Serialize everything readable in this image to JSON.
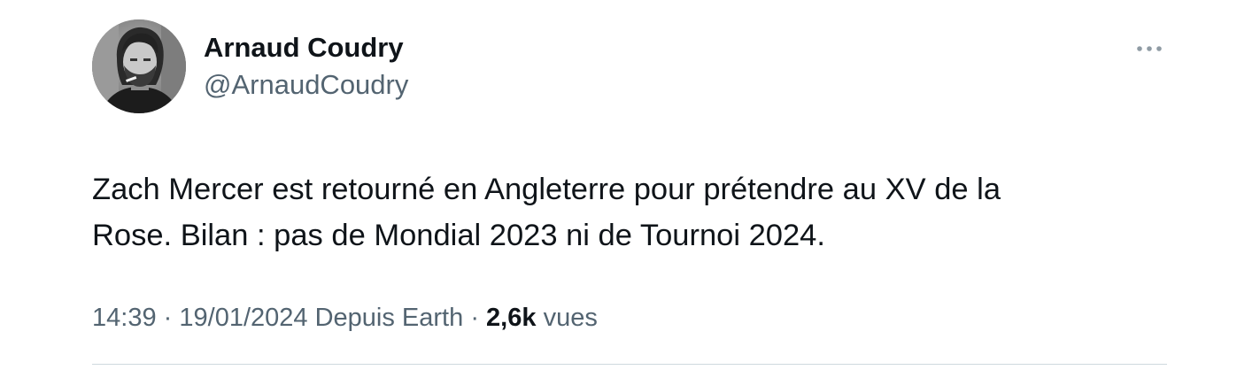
{
  "author": {
    "name": "Arnaud Coudry",
    "handle": "@ArnaudCoudry",
    "avatar_icon": "profile-photo"
  },
  "tweet": {
    "lines": [
      "Zach Mercer est retourné en Angleterre pour prétendre au XV de la",
      "Rose. Bilan : pas de Mondial 2023 ni de Tournoi 2024."
    ]
  },
  "meta": {
    "time": "14:39",
    "separator": "·",
    "date": "19/01/2024",
    "source": "Depuis Earth",
    "views_count": "2,6k",
    "views_label": "vues"
  },
  "icons": {
    "more": "more-horizontal-icon"
  },
  "colors": {
    "text_primary": "#0f1419",
    "text_secondary": "#536471",
    "divider": "#cfd9de",
    "more_icon": "#8f9ba4"
  }
}
